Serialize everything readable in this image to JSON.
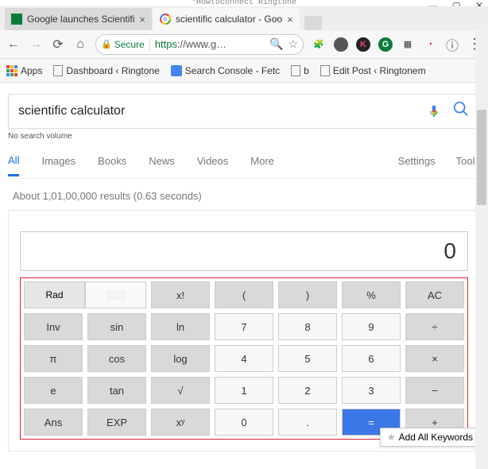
{
  "window": {
    "title": "°Howtoconnect   Ringtone"
  },
  "tabs": [
    {
      "title": "Google launches Scientifi",
      "active": false
    },
    {
      "title": "scientific calculator - Goo",
      "active": true
    }
  ],
  "omnibox": {
    "secure_label": "Secure",
    "protocol": "https",
    "url_display": "://www.g…"
  },
  "bookmarks": {
    "apps_label": "Apps",
    "items": [
      {
        "label": "Dashboard ‹ Ringtone"
      },
      {
        "label": "Search Console - Fetc"
      },
      {
        "label": "b"
      },
      {
        "label": "Edit Post ‹ Ringtonem"
      }
    ]
  },
  "search": {
    "query": "scientific calculator",
    "no_volume": "No search volume"
  },
  "gtabs": {
    "items": [
      "All",
      "Images",
      "Books",
      "News",
      "Videos",
      "More"
    ],
    "settings": "Settings",
    "tools": "Tools"
  },
  "results": {
    "stats": "About 1,01,00,000 results (0.63 seconds)"
  },
  "calc": {
    "display": "0",
    "rows": [
      [
        "Rad",
        "",
        "x!",
        "(",
        ")",
        "%",
        "AC"
      ],
      [
        "Inv",
        "sin",
        "ln",
        "7",
        "8",
        "9",
        "÷"
      ],
      [
        "π",
        "cos",
        "log",
        "4",
        "5",
        "6",
        "×"
      ],
      [
        "e",
        "tan",
        "√",
        "1",
        "2",
        "3",
        "−"
      ],
      [
        "Ans",
        "EXP",
        "xʸ",
        "0",
        ".",
        "=",
        "+"
      ]
    ]
  },
  "keyword_popup": {
    "label": "Add All Keywords"
  }
}
